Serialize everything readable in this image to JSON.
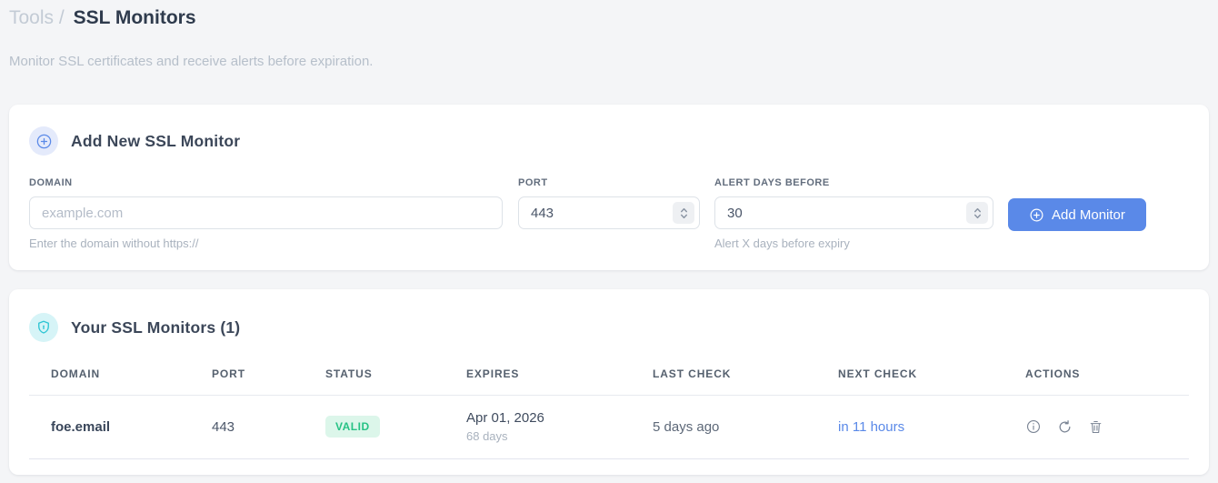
{
  "breadcrumb": {
    "section": "Tools",
    "separator": "/",
    "current": "SSL Monitors"
  },
  "subtitle": "Monitor SSL certificates and receive alerts before expiration.",
  "add_card": {
    "title": "Add New SSL Monitor",
    "fields": {
      "domain": {
        "label": "DOMAIN",
        "placeholder": "example.com",
        "hint": "Enter the domain without https://"
      },
      "port": {
        "label": "PORT",
        "value": "443"
      },
      "alert_days": {
        "label": "ALERT DAYS BEFORE",
        "value": "30",
        "hint": "Alert X days before expiry"
      }
    },
    "submit_label": "Add Monitor"
  },
  "monitors_card": {
    "title": "Your SSL Monitors (1)",
    "table": {
      "headers": [
        "DOMAIN",
        "PORT",
        "STATUS",
        "EXPIRES",
        "LAST CHECK",
        "NEXT CHECK",
        "ACTIONS"
      ],
      "rows": [
        {
          "domain": "foe.email",
          "port": "443",
          "status": "VALID",
          "expires_date": "Apr 01, 2026",
          "expires_days": "68 days",
          "last_check": "5 days ago",
          "next_check": "in 11 hours"
        }
      ]
    }
  },
  "icons": {
    "add_badge": "plus-circle-icon",
    "monitors_badge": "shield-icon",
    "row_actions": [
      "info-icon",
      "refresh-icon",
      "trash-icon"
    ]
  },
  "colors": {
    "accent_blue": "#5a89e8",
    "valid_text": "#27c285",
    "valid_bg": "#dcf6ea",
    "shield_cyan": "#2ec5d3",
    "page_bg": "#f4f5f7"
  }
}
